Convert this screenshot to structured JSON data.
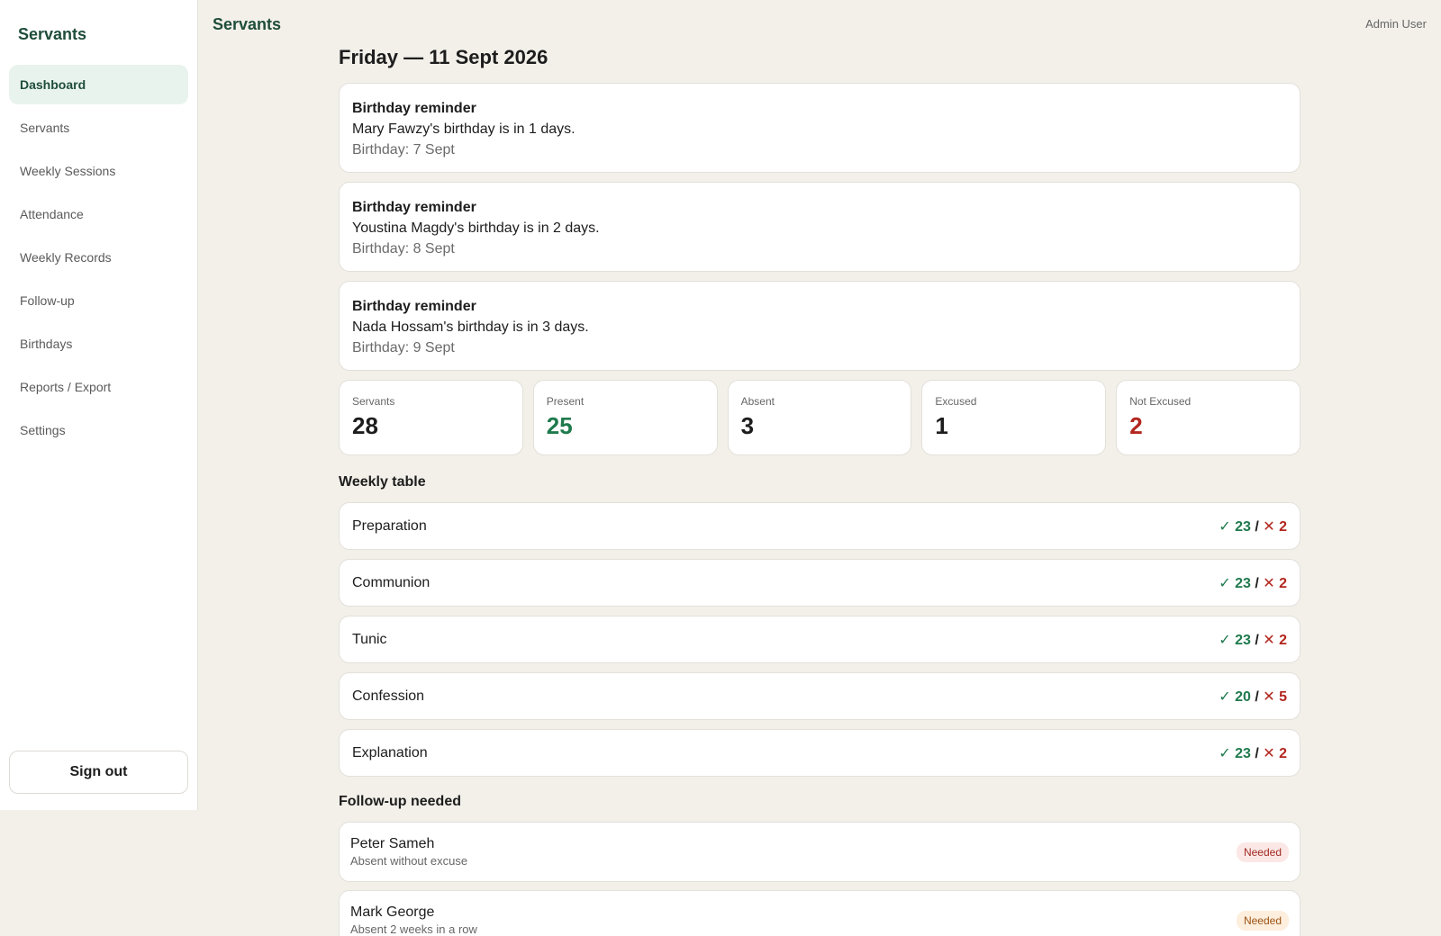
{
  "sidebar": {
    "brand": "Servants",
    "items": [
      {
        "label": "Dashboard",
        "active": true
      },
      {
        "label": "Servants"
      },
      {
        "label": "Weekly Sessions"
      },
      {
        "label": "Attendance"
      },
      {
        "label": "Weekly Records"
      },
      {
        "label": "Follow-up"
      },
      {
        "label": "Birthdays"
      },
      {
        "label": "Reports / Export"
      },
      {
        "label": "Settings"
      }
    ],
    "signout_label": "Sign out"
  },
  "topbar": {
    "title": "Servants",
    "user": "Admin User"
  },
  "main": {
    "date_title": "Friday — 11 Sept 2026",
    "reminders": [
      {
        "title": "Birthday reminder",
        "message": "Mary Fawzy's birthday is in 1 days.",
        "date": "Birthday: 7 Sept"
      },
      {
        "title": "Birthday reminder",
        "message": "Youstina Magdy's birthday is in 2 days.",
        "date": "Birthday: 8 Sept"
      },
      {
        "title": "Birthday reminder",
        "message": "Nada Hossam's birthday is in 3 days.",
        "date": "Birthday: 9 Sept"
      }
    ],
    "stats": [
      {
        "label": "Servants",
        "value": "28",
        "color": "#1d1d1d"
      },
      {
        "label": "Present",
        "value": "25",
        "color": "#1f7a4d"
      },
      {
        "label": "Absent",
        "value": "3",
        "color": "#1d1d1d"
      },
      {
        "label": "Excused",
        "value": "1",
        "color": "#1d1d1d"
      },
      {
        "label": "Not Excused",
        "value": "2",
        "color": "#b3261e"
      }
    ],
    "weekly_title": "Weekly table",
    "weekly": [
      {
        "name": "Preparation",
        "yes": "✓ 23",
        "sep": "/",
        "no": "✕ 2"
      },
      {
        "name": "Communion",
        "yes": "✓ 23",
        "sep": "/",
        "no": "✕ 2"
      },
      {
        "name": "Tunic",
        "yes": "✓ 23",
        "sep": "/",
        "no": "✕ 2"
      },
      {
        "name": "Confession",
        "yes": "✓ 20",
        "sep": "/",
        "no": "✕ 5"
      },
      {
        "name": "Explanation",
        "yes": "✓ 23",
        "sep": "/",
        "no": "✕ 2"
      }
    ],
    "followup_title": "Follow-up needed",
    "followups": [
      {
        "name": "Peter Sameh",
        "reason": "Absent without excuse",
        "badge": "Needed"
      },
      {
        "name": "Mark George",
        "reason": "Absent 2 weeks in a row",
        "badge": "Needed"
      }
    ]
  },
  "colors": {
    "accent": "#1f4d3a",
    "present": "#1f7a4d",
    "absent": "#b3261e",
    "background": "#f3f0ea"
  }
}
